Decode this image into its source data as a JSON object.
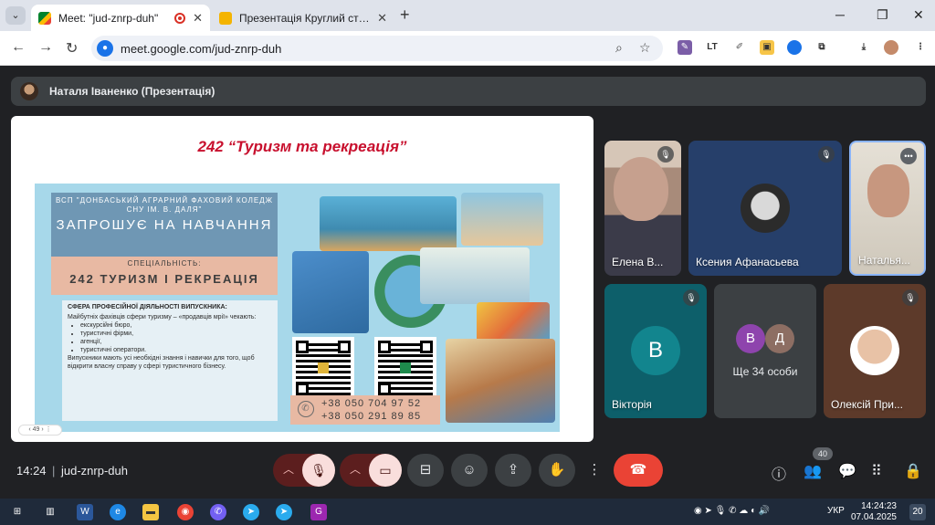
{
  "browser": {
    "tabs": [
      {
        "title": "Meet: \"jud-znrp-duh\"",
        "active": true
      },
      {
        "title": "Презентація Круглий стіл «Мо",
        "active": false
      }
    ],
    "url": "meet.google.com/jud-znrp-duh"
  },
  "meet": {
    "presenter": "Наталя Іваненко (Презентація)",
    "slide": {
      "title": "242 “Туризм та рекреація”",
      "poster": {
        "org": "ВСП \"ДОНБАСЬКИЙ АГРАРНИЙ ФАХОВИЙ КОЛЕДЖ СНУ ІМ. В. ДАЛЯ\"",
        "invite": "ЗАПРОШУЄ НА НАВЧАННЯ",
        "spec_label": "СПЕЦІАЛЬНІСТЬ:",
        "spec": "242 ТУРИЗМ І РЕКРЕАЦІЯ",
        "sphere_heading": "СФЕРА ПРОФЕСІЙНОЇ ДІЯЛЬНОСТІ ВИПУСКНИКА:",
        "sphere_text": "Майбутніх фахівців сфери туризму – «продавців мрії» чекають:",
        "sphere_items": [
          "екскурсійні бюро,",
          "туристичні фірми,",
          "агенції,",
          "туристичні оператори."
        ],
        "sphere_footer": "Випускники мають усі необхідні знання і навички для того, щоб відкрити власну справу у сфері туристичного бізнесу.",
        "phones": [
          "+38 050 704 97 52",
          "+38 050 291 89 85"
        ]
      },
      "page_control": "‹ 49 › ⋮"
    },
    "participants": [
      {
        "name": "Елена В...",
        "muted": true
      },
      {
        "name": "Ксения Афанасьева",
        "muted": true
      },
      {
        "name": "Наталья...",
        "muted": false
      },
      {
        "name": "Вікторія",
        "initial": "В",
        "muted": true,
        "color": "#12858e"
      },
      {
        "name": "Ще 34 особи",
        "initials": [
          "В",
          "Д"
        ],
        "colors": [
          "#8e44ad",
          "#8d6e63"
        ]
      },
      {
        "name": "Олексій При...",
        "muted": true
      }
    ],
    "time": "14:24",
    "meeting_code": "jud-znrp-duh",
    "participant_count": "40"
  },
  "taskbar": {
    "lang": "УКР",
    "time": "14:24:23",
    "date": "07.04.2025",
    "notifications": "20"
  }
}
